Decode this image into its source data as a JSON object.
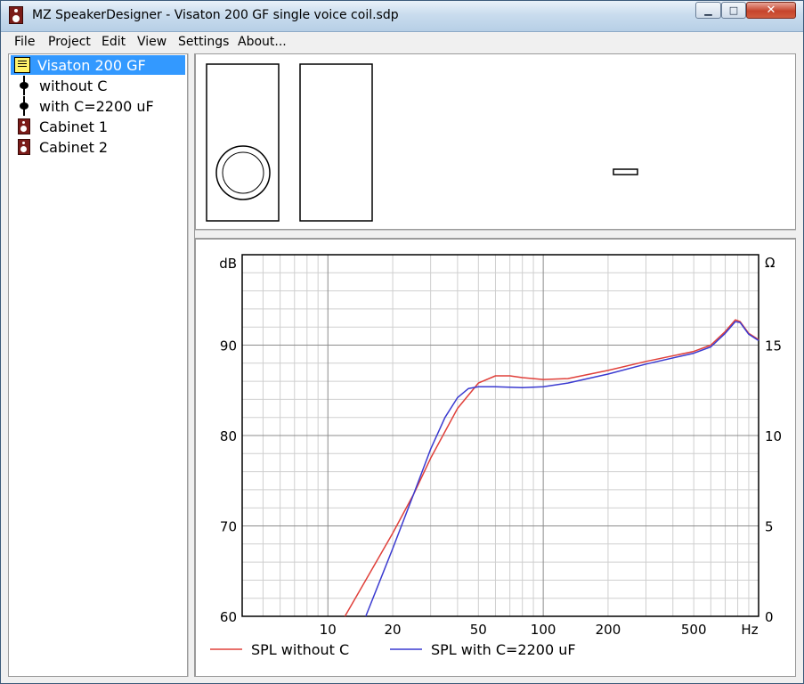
{
  "window": {
    "title": "MZ SpeakerDesigner - Visaton 200 GF single voice coil.sdp"
  },
  "menu": [
    "File",
    "Project",
    "Edit",
    "View",
    "Settings",
    "About..."
  ],
  "tree": [
    {
      "label": "Visaton 200 GF",
      "icon": "note-icon",
      "selected": true
    },
    {
      "label": "without C",
      "icon": "node-icon"
    },
    {
      "label": "with C=2200 uF",
      "icon": "node-icon"
    },
    {
      "label": "Cabinet 1",
      "icon": "cabinet-icon"
    },
    {
      "label": "Cabinet 2",
      "icon": "cabinet-icon"
    }
  ],
  "chart_data": {
    "type": "line",
    "xscale": "log",
    "xlim": [
      4,
      1000
    ],
    "ylim": [
      60,
      100
    ],
    "y2lim": [
      0,
      20
    ],
    "xlabel": "Hz",
    "ylabel": "dB",
    "y2label": "Ω",
    "x_ticks": [
      10,
      20,
      50,
      100,
      200,
      500
    ],
    "y_ticks": [
      60,
      70,
      80,
      90
    ],
    "y2_ticks": [
      0,
      5,
      10,
      15
    ],
    "grid": true,
    "legend": "bottom",
    "series": [
      {
        "name": "SPL without C",
        "color": "#e0403a",
        "points": [
          [
            12,
            60
          ],
          [
            15,
            64
          ],
          [
            20,
            69.2
          ],
          [
            25,
            73.5
          ],
          [
            30,
            77.5
          ],
          [
            40,
            83
          ],
          [
            50,
            85.8
          ],
          [
            60,
            86.6
          ],
          [
            70,
            86.6
          ],
          [
            80,
            86.4
          ],
          [
            100,
            86.2
          ],
          [
            130,
            86.3
          ],
          [
            200,
            87.2
          ],
          [
            300,
            88.2
          ],
          [
            500,
            89.3
          ],
          [
            600,
            90
          ],
          [
            700,
            91.5
          ],
          [
            780,
            92.8
          ],
          [
            820,
            92.6
          ],
          [
            900,
            91.3
          ],
          [
            1000,
            90.6
          ]
        ]
      },
      {
        "name": "SPL with C=2200 uF",
        "color": "#3a3ad0",
        "points": [
          [
            15,
            60
          ],
          [
            20,
            67.5
          ],
          [
            25,
            73.5
          ],
          [
            30,
            78.5
          ],
          [
            35,
            82
          ],
          [
            40,
            84.2
          ],
          [
            45,
            85.2
          ],
          [
            50,
            85.4
          ],
          [
            60,
            85.4
          ],
          [
            80,
            85.3
          ],
          [
            100,
            85.4
          ],
          [
            130,
            85.8
          ],
          [
            200,
            86.8
          ],
          [
            300,
            87.9
          ],
          [
            500,
            89.1
          ],
          [
            600,
            89.8
          ],
          [
            700,
            91.3
          ],
          [
            780,
            92.6
          ],
          [
            820,
            92.5
          ],
          [
            900,
            91.2
          ],
          [
            1000,
            90.5
          ]
        ]
      }
    ]
  }
}
